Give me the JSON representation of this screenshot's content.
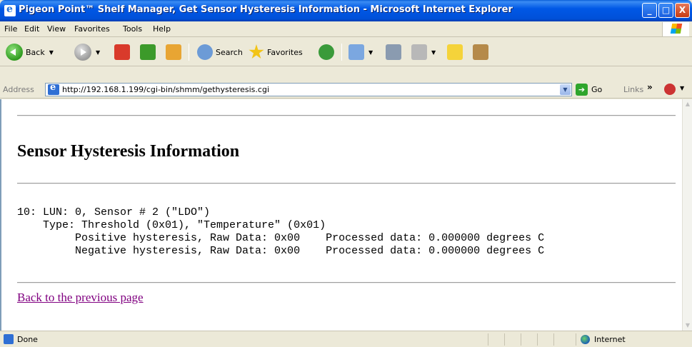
{
  "window": {
    "title": "Pigeon Point™ Shelf Manager, Get Sensor Hysteresis Information - Microsoft Internet Explorer",
    "min_label": "_",
    "max_label": "□",
    "close_label": "X"
  },
  "menu": {
    "items": [
      "File",
      "Edit",
      "View",
      "Favorites",
      "Tools",
      "Help"
    ]
  },
  "toolbar": {
    "back_label": "Back",
    "search_label": "Search",
    "favorites_label": "Favorites"
  },
  "address": {
    "label": "Address",
    "url": "http://192.168.1.199/cgi-bin/shmm/gethysteresis.cgi",
    "go_label": "Go",
    "links_label": "Links",
    "links_more": "»"
  },
  "page": {
    "heading": "Sensor Hysteresis Information",
    "sensor_line": "10: LUN: 0, Sensor # 2 (\"LDO\")",
    "type_line": "    Type: Threshold (0x01), \"Temperature\" (0x01)",
    "positive_line": "         Positive hysteresis, Raw Data: 0x00    Processed data: 0.000000 degrees C",
    "negative_line": "         Negative hysteresis, Raw Data: 0x00    Processed data: 0.000000 degrees C",
    "back_link": "Back to the previous page"
  },
  "status": {
    "text": "Done",
    "zone": "Internet"
  }
}
